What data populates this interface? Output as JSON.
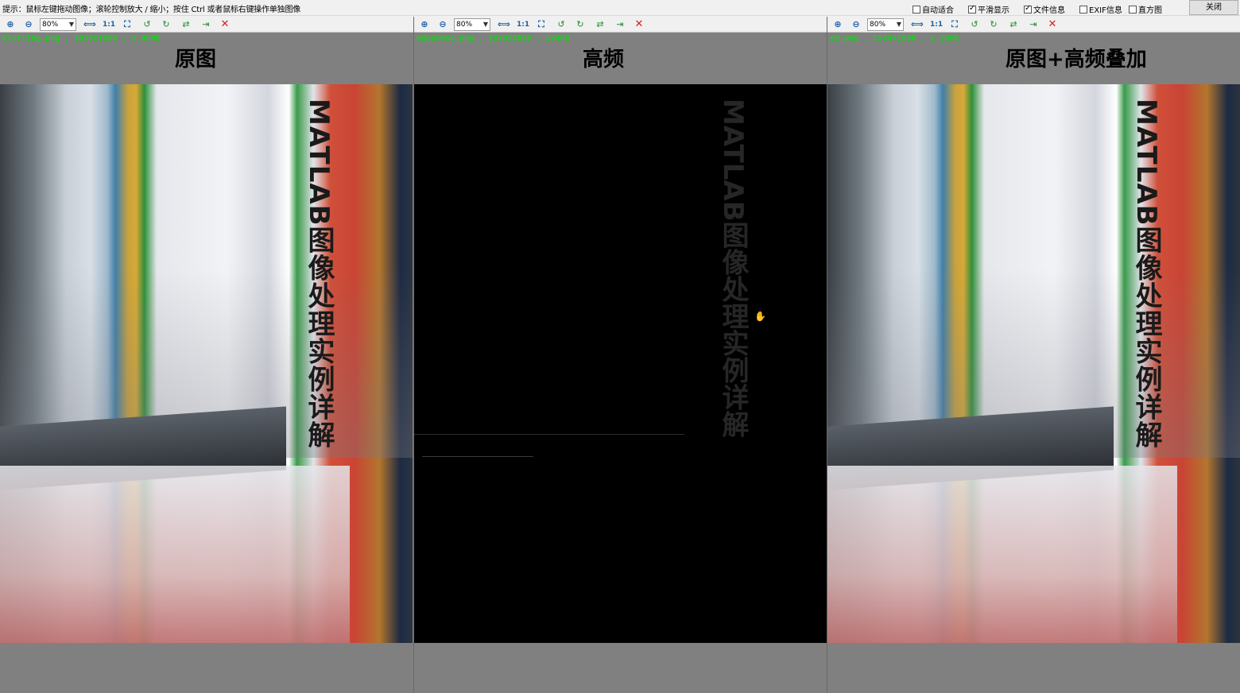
{
  "topbar": {
    "hint": "提示：鼠标左键拖动图像；滚轮控制放大 / 缩小；按住 Ctrl 或者鼠标右键操作单独图像",
    "checkboxes": [
      {
        "label": "自动适合",
        "checked": false
      },
      {
        "label": "平滑显示",
        "checked": true
      },
      {
        "label": "文件信息",
        "checked": true
      },
      {
        "label": "EXIF信息",
        "checked": false
      },
      {
        "label": "直方图",
        "checked": false
      }
    ],
    "close_label": "关闭"
  },
  "toolbar": {
    "zoom": "80%",
    "one_to_one": "1:1",
    "icons": [
      "zoom-in-icon",
      "zoom-out-icon",
      "fit-icon",
      "actual-size-icon",
      "fullscreen-icon",
      "rotate-left-icon",
      "rotate-right-icon",
      "flip-icon",
      "export-icon",
      "close-icon"
    ]
  },
  "panels": [
    {
      "fileinfo": "blurring.png , 1920x1080 , 3.46MB",
      "title": "原图",
      "book_text": "MATLAB图像处理实例详解"
    },
    {
      "fileinfo": "edgeDemo.png , 1920x1080 , 224KB",
      "title": "高频",
      "book_text": "MATLAB图像处理实例详解"
    },
    {
      "fileinfo": "ee.png , 1920x1080 , 2.26MB",
      "title": "原图+高频叠加",
      "book_text": "MATLAB图像处理实例详解"
    }
  ],
  "colors": {
    "fileinfo": "#16d416",
    "panel_bg": "#808080",
    "close_x": "#d6201e"
  }
}
